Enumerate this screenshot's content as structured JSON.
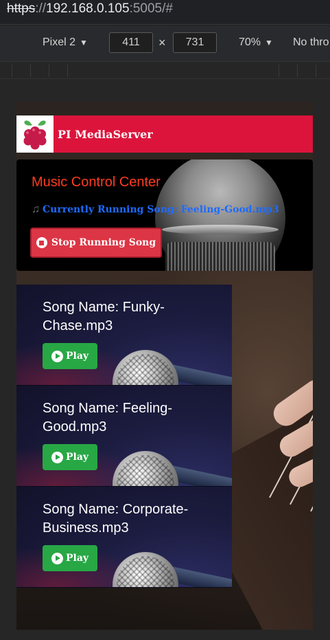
{
  "browser": {
    "url_scheme": "https",
    "url_sep": "://",
    "url_host": "192.168.0.105",
    "url_rest": ":5005/#"
  },
  "devtools": {
    "device": "Pixel 2",
    "width": "411",
    "times": "×",
    "height": "731",
    "zoom": "70%",
    "throttle": "No thro",
    "caret": "▼"
  },
  "navbar": {
    "brand": "PI MediaServer",
    "logo_icon": "raspberry-pi-icon"
  },
  "control": {
    "title": "Music Control Center",
    "note_icon": "♫",
    "now_playing": "Currently Running Song: Feeling-Good.mp3",
    "stop_label": "Stop Running Song"
  },
  "songs": [
    {
      "name": "Song Name: Funky-Chase.mp3",
      "play_label": "Play"
    },
    {
      "name": "Song Name: Feeling-Good.mp3",
      "play_label": "Play"
    },
    {
      "name": "Song Name: Corporate-Business.mp3",
      "play_label": "Play"
    }
  ],
  "colors": {
    "navbar": "#dc143c",
    "title": "#ff3b1f",
    "now_playing": "#1e6bff",
    "stop_button": "#dc3545",
    "play_button": "#28a745"
  }
}
